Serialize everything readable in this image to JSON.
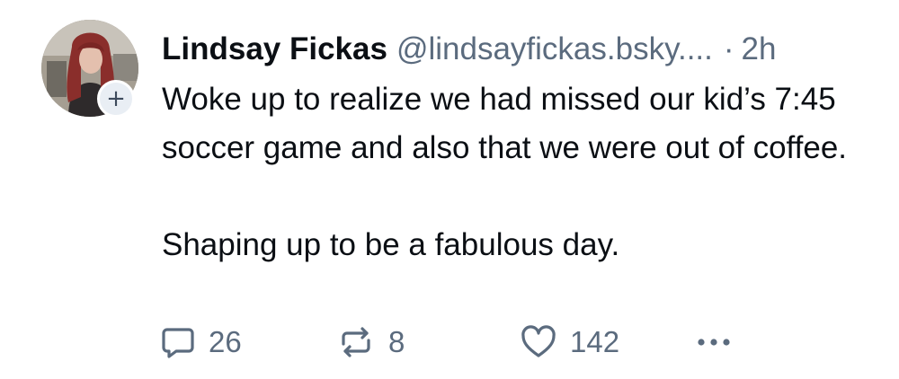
{
  "post": {
    "author": {
      "display_name": "Lindsay Fickas",
      "handle": "@lindsayfickas.bsky....",
      "avatar_icon": "avatar-photo"
    },
    "separator": "·",
    "time": "2h",
    "follow_symbol": "+",
    "text_paragraphs": [
      "Woke up to realize we had missed our kid’s 7:45 soccer game and also that we were out of coffee.",
      "Shaping up to be a fabulous day."
    ],
    "actions": {
      "reply_count": "26",
      "repost_count": "8",
      "like_count": "142",
      "reply_icon": "speech-bubble-icon",
      "repost_icon": "repost-arrows-icon",
      "like_icon": "heart-icon",
      "more_icon": "ellipsis-icon"
    }
  },
  "colors": {
    "text_primary": "#0b0f14",
    "text_secondary": "#5b6b7e",
    "follow_button_bg": "#e9eef4"
  }
}
